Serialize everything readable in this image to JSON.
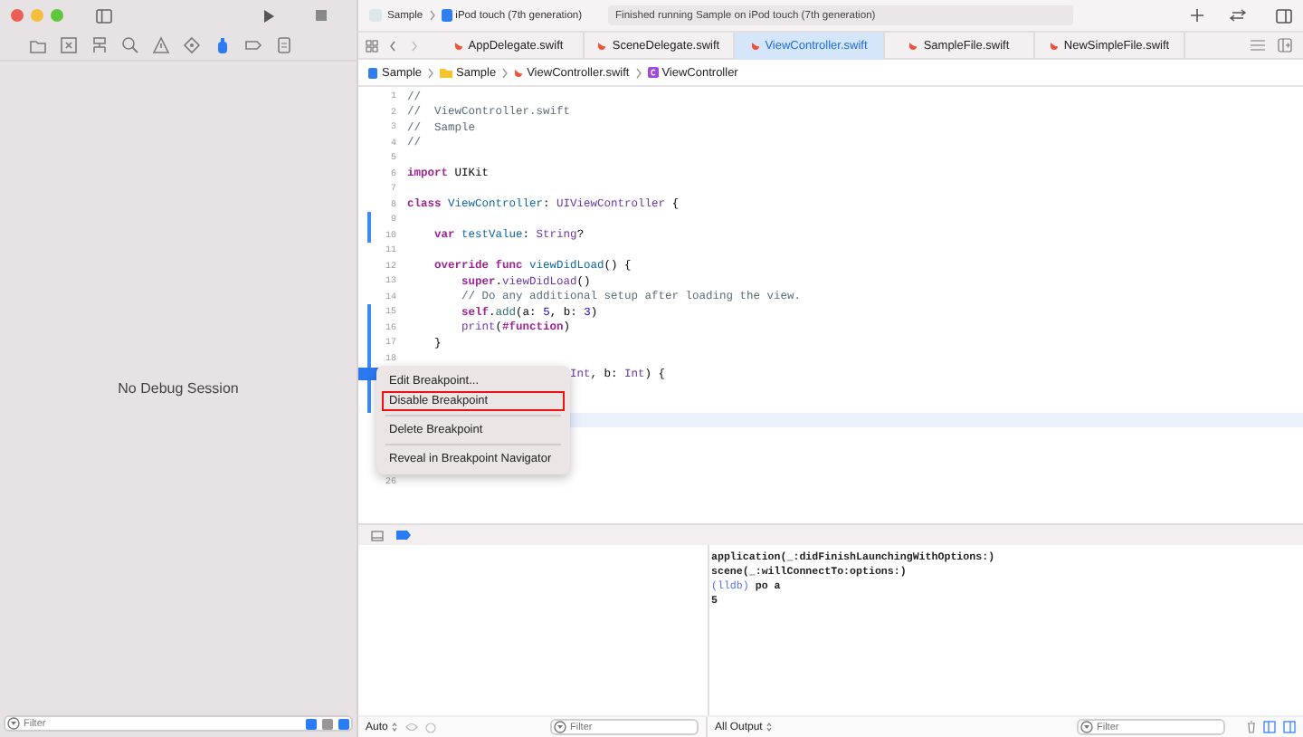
{
  "toolbar": {
    "scheme": "Sample",
    "device": "iPod touch (7th generation)",
    "status": "Finished running Sample on iPod touch (7th generation)"
  },
  "navigator_tabs": [
    {
      "selected": false
    },
    {
      "selected": false
    },
    {
      "selected": false
    },
    {
      "selected": false
    },
    {
      "selected": false
    },
    {
      "selected": false
    },
    {
      "selected": true
    },
    {
      "selected": false
    },
    {
      "selected": false
    }
  ],
  "debug_navigator": {
    "empty_message": "No Debug Session",
    "filter": {
      "placeholder": "Filter"
    },
    "toggles": [
      {
        "on": true
      },
      {
        "on": false
      },
      {
        "on": true
      }
    ]
  },
  "tabs": [
    {
      "label": "AppDelegate.swift",
      "selected": false
    },
    {
      "label": "SceneDelegate.swift",
      "selected": false
    },
    {
      "label": "ViewController.swift",
      "selected": true
    },
    {
      "label": "SampleFile.swift",
      "selected": false
    },
    {
      "label": "NewSimpleFile.swift",
      "selected": false
    }
  ],
  "jump_bar": [
    {
      "kind": "project",
      "label": "Sample"
    },
    {
      "kind": "folder",
      "label": "Sample"
    },
    {
      "kind": "swift",
      "label": "ViewController.swift"
    },
    {
      "kind": "class",
      "label": "ViewController"
    }
  ],
  "editor": {
    "lines": [
      {
        "number": "1",
        "covered": false,
        "changed": false,
        "breakpoint": false,
        "highlighted": false,
        "segments": [
          {
            "kind": "comment",
            "text": "//"
          }
        ]
      },
      {
        "number": "2",
        "covered": false,
        "changed": false,
        "breakpoint": false,
        "highlighted": false,
        "segments": [
          {
            "kind": "comment",
            "text": "//  ViewController.swift"
          }
        ]
      },
      {
        "number": "3",
        "covered": false,
        "changed": false,
        "breakpoint": false,
        "highlighted": false,
        "segments": [
          {
            "kind": "comment",
            "text": "//  Sample"
          }
        ]
      },
      {
        "number": "4",
        "covered": false,
        "changed": false,
        "breakpoint": false,
        "highlighted": false,
        "segments": [
          {
            "kind": "comment",
            "text": "//"
          }
        ]
      },
      {
        "number": "5",
        "changed": false,
        "breakpoint": false,
        "highlighted": false
      },
      {
        "number": "6",
        "covered": false,
        "changed": false,
        "breakpoint": false,
        "highlighted": false,
        "segments": [
          {
            "kind": "keyword",
            "text": "import"
          },
          {
            "kind": "plain",
            "text": " UIKit"
          }
        ]
      },
      {
        "number": "7",
        "changed": false,
        "breakpoint": false,
        "highlighted": false
      },
      {
        "number": "8",
        "covered": false,
        "changed": false,
        "breakpoint": false,
        "highlighted": false,
        "segments": [
          {
            "kind": "keyword",
            "text": "class"
          },
          {
            "kind": "declaration",
            "text": " ViewController"
          },
          {
            "kind": "plain",
            "text": ": "
          },
          {
            "kind": "type",
            "text": "UIViewController"
          },
          {
            "kind": "plain",
            "text": " {"
          }
        ]
      },
      {
        "number": "9",
        "changed": true,
        "breakpoint": false,
        "highlighted": false
      },
      {
        "number": "10",
        "covered": false,
        "changed": true,
        "breakpoint": false,
        "highlighted": false,
        "segments": [
          {
            "kind": "keyword",
            "text": "    var"
          },
          {
            "kind": "declaration",
            "text": " testValue"
          },
          {
            "kind": "plain",
            "text": ": "
          },
          {
            "kind": "type",
            "text": "String"
          },
          {
            "kind": "plain",
            "text": "?"
          }
        ]
      },
      {
        "number": "11",
        "changed": false,
        "breakpoint": false,
        "highlighted": false
      },
      {
        "number": "12",
        "covered": false,
        "changed": false,
        "breakpoint": false,
        "highlighted": false,
        "segments": [
          {
            "kind": "keyword",
            "text": "    override func"
          },
          {
            "kind": "declaration",
            "text": " viewDidLoad"
          },
          {
            "kind": "plain",
            "text": "() {"
          }
        ]
      },
      {
        "number": "13",
        "covered": false,
        "changed": false,
        "breakpoint": false,
        "highlighted": false,
        "segments": [
          {
            "kind": "keyword",
            "text": "        super"
          },
          {
            "kind": "plain",
            "text": "."
          },
          {
            "kind": "type",
            "text": "viewDidLoad"
          },
          {
            "kind": "plain",
            "text": "()"
          }
        ]
      },
      {
        "number": "14",
        "covered": false,
        "changed": false,
        "breakpoint": false,
        "highlighted": false,
        "segments": [
          {
            "kind": "comment",
            "text": "        // Do any additional setup after loading the view."
          }
        ]
      },
      {
        "number": "15",
        "covered": false,
        "changed": true,
        "breakpoint": false,
        "highlighted": false,
        "segments": [
          {
            "kind": "keyword",
            "text": "        self"
          },
          {
            "kind": "plain",
            "text": "."
          },
          {
            "kind": "call",
            "text": "add"
          },
          {
            "kind": "plain",
            "text": "(a: "
          },
          {
            "kind": "number",
            "text": "5"
          },
          {
            "kind": "plain",
            "text": ", b: "
          },
          {
            "kind": "number",
            "text": "3"
          },
          {
            "kind": "plain",
            "text": ")"
          }
        ]
      },
      {
        "number": "16",
        "covered": false,
        "changed": true,
        "breakpoint": false,
        "highlighted": false,
        "segments": [
          {
            "kind": "type",
            "text": "        print"
          },
          {
            "kind": "plain",
            "text": "("
          },
          {
            "kind": "keyword",
            "text": "#function"
          },
          {
            "kind": "plain",
            "text": ")"
          }
        ]
      },
      {
        "number": "17",
        "covered": false,
        "changed": true,
        "breakpoint": false,
        "highlighted": false,
        "segments": [
          {
            "kind": "plain",
            "text": "    }"
          }
        ]
      },
      {
        "number": "18",
        "changed": true,
        "breakpoint": false,
        "highlighted": false
      },
      {
        "covered": true,
        "changed": true,
        "breakpoint": true,
        "highlighted": false,
        "segments": [
          {
            "kind": "type",
            "text": "Int"
          },
          {
            "kind": "plain",
            "text": ", b: "
          },
          {
            "kind": "type",
            "text": "Int"
          },
          {
            "kind": "plain",
            "text": ") {"
          }
        ]
      },
      {
        "changed": true,
        "breakpoint": false,
        "highlighted": false
      },
      {
        "changed": true,
        "breakpoint": false,
        "highlighted": false
      },
      {
        "changed": false,
        "breakpoint": false,
        "highlighted": true
      },
      {
        "changed": false,
        "breakpoint": false,
        "highlighted": false
      },
      {
        "changed": false,
        "breakpoint": false,
        "highlighted": false
      },
      {
        "changed": false,
        "breakpoint": false,
        "highlighted": false
      },
      {
        "number": "26",
        "changed": false,
        "breakpoint": false,
        "highlighted": false
      }
    ]
  },
  "context_menu": {
    "groups": [
      [
        {
          "label": "Edit Breakpoint...",
          "outlined": false
        },
        {
          "label": "Disable Breakpoint",
          "outlined": true
        }
      ],
      [
        {
          "label": "Delete Breakpoint",
          "outlined": false
        }
      ],
      [
        {
          "label": "Reveal in Breakpoint Navigator",
          "outlined": false
        }
      ]
    ]
  },
  "console": {
    "lines": [
      [
        {
          "kind": "output",
          "text": "application(_:didFinishLaunchingWithOptions:)"
        }
      ],
      [
        {
          "kind": "output",
          "text": "scene(_:willConnectTo:options:)"
        }
      ],
      [
        {
          "kind": "prompt",
          "text": "(lldb)"
        },
        {
          "kind": "output",
          "text": " po a"
        }
      ],
      [
        {
          "kind": "output",
          "text": "5"
        }
      ]
    ]
  },
  "debug_bar": {
    "variables_scope": "Auto",
    "variables_filter": {
      "placeholder": "Filter"
    },
    "output_scope": "All Output",
    "output_filter": {
      "placeholder": "Filter"
    }
  }
}
